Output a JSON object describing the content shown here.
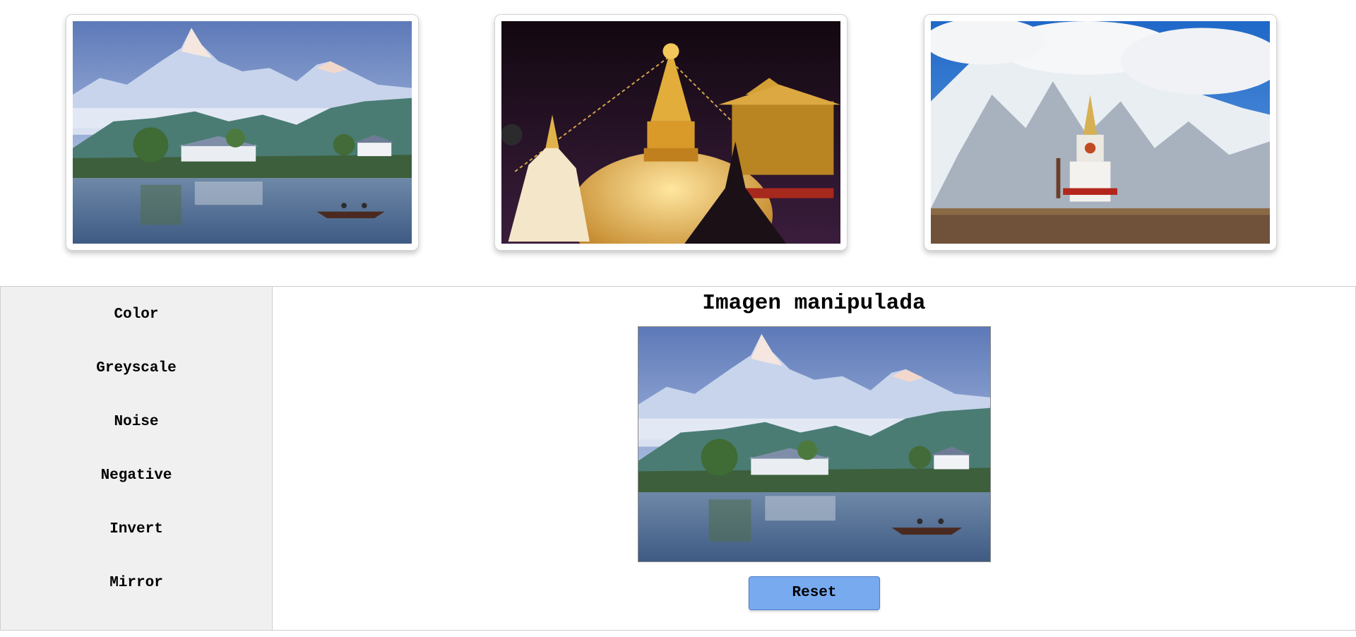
{
  "gallery": {
    "images": [
      {
        "name": "mountain-lake-painting"
      },
      {
        "name": "golden-stupa-night"
      },
      {
        "name": "snow-peak-stupa"
      }
    ]
  },
  "sidebar": {
    "filters": [
      "Color",
      "Greyscale",
      "Noise",
      "Negative",
      "Invert",
      "Mirror"
    ]
  },
  "main": {
    "title": "Imagen manipulada",
    "reset_label": "Reset"
  },
  "colors": {
    "sidebar_bg": "#f0f0f0",
    "reset_bg": "#78aaf0"
  }
}
